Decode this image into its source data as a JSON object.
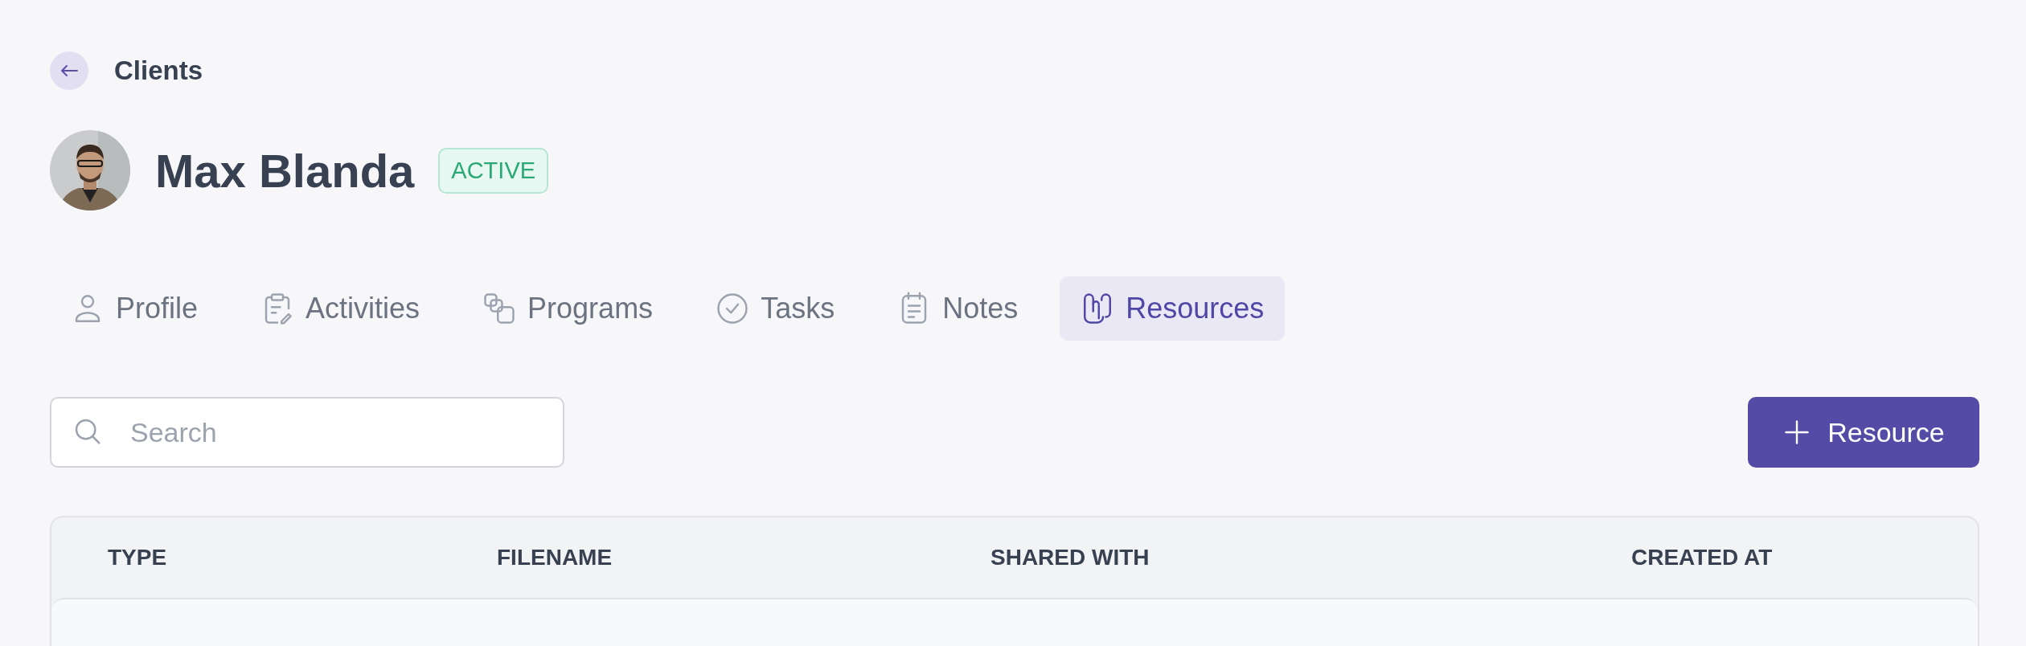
{
  "breadcrumb": {
    "label": "Clients"
  },
  "client": {
    "name": "Max Blanda",
    "status": "ACTIVE"
  },
  "tabs": [
    {
      "label": "Profile",
      "kind": "person",
      "selected": false
    },
    {
      "label": "Activities",
      "kind": "clipboard",
      "selected": false
    },
    {
      "label": "Programs",
      "kind": "copies",
      "selected": false
    },
    {
      "label": "Tasks",
      "kind": "check",
      "selected": false
    },
    {
      "label": "Notes",
      "kind": "notepad",
      "selected": false
    },
    {
      "label": "Resources",
      "kind": "clip",
      "selected": true
    }
  ],
  "search": {
    "placeholder": "Search"
  },
  "add_button": {
    "label": "Resource"
  },
  "table": {
    "columns": [
      "TYPE",
      "FILENAME",
      "SHARED WITH",
      "CREATED AT"
    ]
  }
}
